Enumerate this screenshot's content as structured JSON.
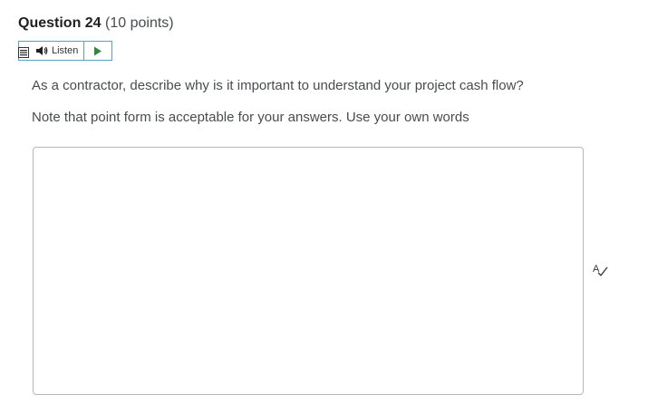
{
  "question": {
    "title": "Question 24",
    "points": "(10 points)"
  },
  "listen": {
    "label": "Listen",
    "menu_icon": "menu-icon",
    "speaker_icon": "speaker-icon",
    "play_icon": "play-icon",
    "border_color": "#5aa0c8",
    "play_color": "#2e8b3a"
  },
  "prompt": {
    "line1": "As a contractor, describe why is it important to understand your project cash flow?",
    "line2": "Note that point form is acceptable for your answers.  Use your own words"
  },
  "answer": {
    "value": "",
    "placeholder": ""
  },
  "spellcheck": {
    "icon": "spellcheck-icon"
  }
}
